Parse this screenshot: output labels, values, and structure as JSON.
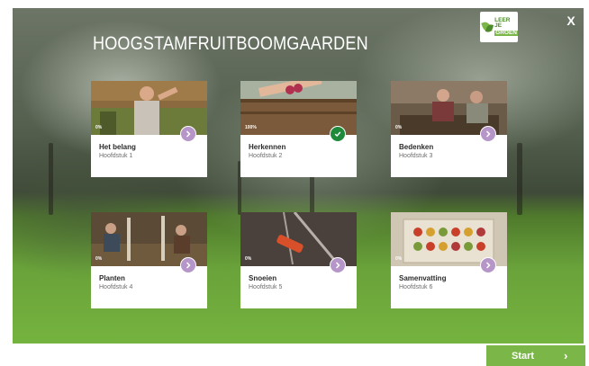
{
  "header": {
    "title": "HOOGSTAMFRUITBOOMGAARDEN",
    "logo_line1": "LEER JE",
    "logo_line2": "GROEN",
    "close_label": "X"
  },
  "chapters": [
    {
      "title": "Het belang",
      "subtitle": "Hoofdstuk 1",
      "progress_label": "0%",
      "status": "arrow-icon"
    },
    {
      "title": "Herkennen",
      "subtitle": "Hoofdstuk 2",
      "progress_label": "100%",
      "status": "check-icon"
    },
    {
      "title": "Bedenken",
      "subtitle": "Hoofdstuk 3",
      "progress_label": "0%",
      "status": "arrow-icon"
    },
    {
      "title": "Planten",
      "subtitle": "Hoofdstuk 4",
      "progress_label": "0%",
      "status": "arrow-icon"
    },
    {
      "title": "Snoeien",
      "subtitle": "Hoofdstuk 5",
      "progress_label": "0%",
      "status": "arrow-icon"
    },
    {
      "title": "Samenvatting",
      "subtitle": "Hoofdstuk 6",
      "progress_label": "0%",
      "status": "arrow-icon"
    }
  ],
  "footer": {
    "start_label": "Start",
    "start_icon": "chevron-right-icon"
  },
  "colors": {
    "accent_green": "#7ab648",
    "complete_badge": "#1f8a3a",
    "pending_badge": "#b695c9"
  }
}
